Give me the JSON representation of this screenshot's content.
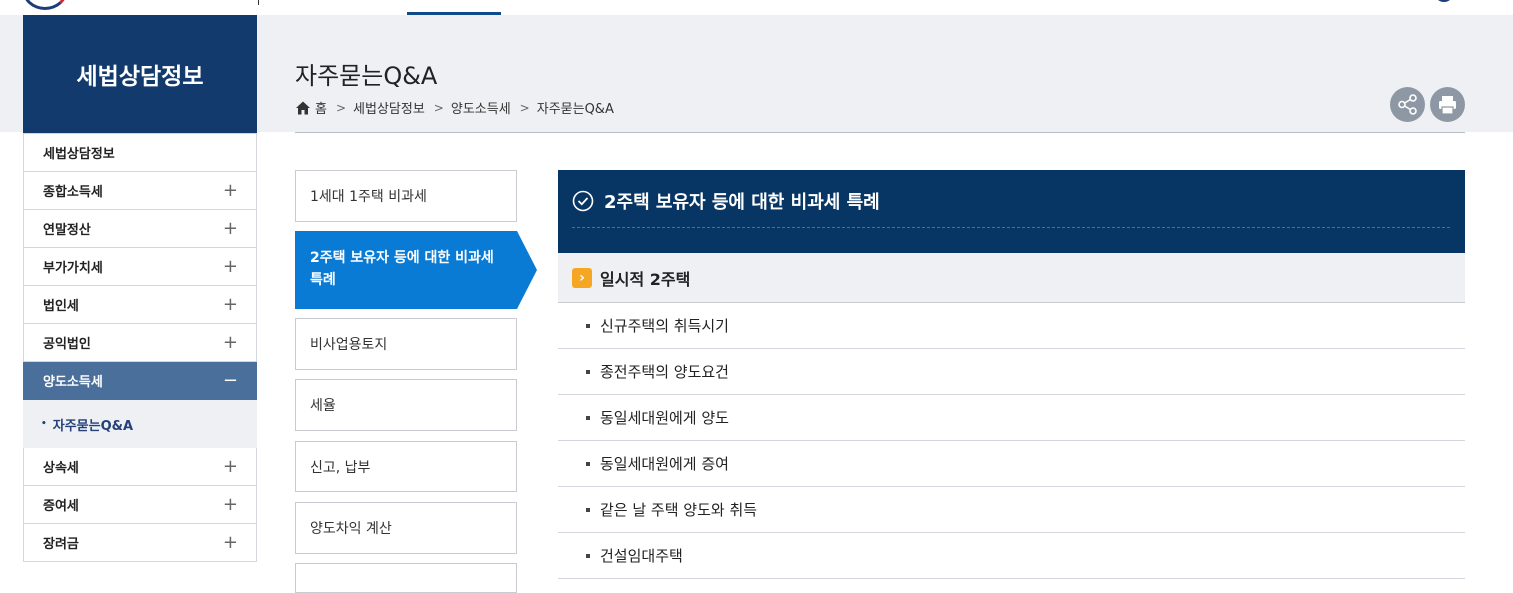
{
  "lnb": {
    "title": "세법상담정보",
    "items": [
      {
        "label": "세법상담정보"
      },
      {
        "label": "종합소득세",
        "expand": "+"
      },
      {
        "label": "연말정산",
        "expand": "+"
      },
      {
        "label": "부가가치세",
        "expand": "+"
      },
      {
        "label": "법인세",
        "expand": "+"
      },
      {
        "label": "공익법인",
        "expand": "+"
      },
      {
        "label": "양도소득세",
        "expand": "−",
        "active": true
      },
      {
        "label": "상속세",
        "expand": "+"
      },
      {
        "label": "증여세",
        "expand": "+"
      },
      {
        "label": "장려금",
        "expand": "+"
      }
    ],
    "sub_item": "자주묻는Q&A"
  },
  "page": {
    "title": "자주묻는Q&A",
    "breadcrumb": [
      "홈",
      "세법상담정보",
      "양도소득세",
      "자주묻는Q&A"
    ]
  },
  "tabs": [
    {
      "label": "1세대 1주택 비과세"
    },
    {
      "label": "2주택 보유자 등에 대한 비과세 특례",
      "active": true
    },
    {
      "label": "비사업용토지"
    },
    {
      "label": "세율"
    },
    {
      "label": "신고, 납부"
    },
    {
      "label": "양도차익 계산"
    }
  ],
  "panel": {
    "title": "2주택 보유자 등에 대한 비과세 특례",
    "section": {
      "badge": "›",
      "label": "일시적 2주택"
    },
    "items": [
      "신규주택의 취득시기",
      "종전주택의 양도요건",
      "동일세대원에게 양도",
      "동일세대원에게 증여",
      "같은 날 주택 양도와 취득",
      "건설임대주택"
    ]
  },
  "colors": {
    "primary": "#123a6c",
    "active_tab": "#0a7bd5",
    "accent": "#f5a623",
    "panel_head": "#083664"
  },
  "icons": [
    "home-icon",
    "share-icon",
    "print-icon",
    "check-circle-icon",
    "chevron-right-icon"
  ]
}
